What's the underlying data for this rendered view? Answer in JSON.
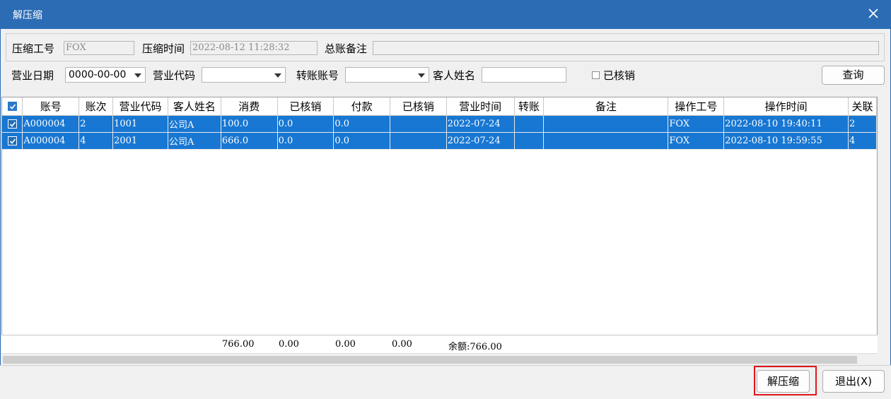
{
  "window": {
    "title": "解压缩",
    "close_label": "×"
  },
  "info": {
    "operator_label": "压缩工号",
    "operator_value": "FOX",
    "time_label": "压缩时间",
    "time_value": "2022-08-12 11:28:32",
    "note_label": "总账备注",
    "note_value": ""
  },
  "filters": {
    "date_label": "营业日期",
    "date_value": "0000-00-00",
    "code_label": "营业代码",
    "code_value": "",
    "account_label": "转账账号",
    "account_value": "",
    "customer_label": "客人姓名",
    "customer_value": "",
    "verified_label": "已核销",
    "verified_checked": false,
    "query_button": "查询"
  },
  "table": {
    "columns": [
      "账号",
      "账次",
      "营业代码",
      "客人姓名",
      "消费",
      "已核销",
      "付款",
      "已核销",
      "营业时间",
      "转账",
      "备注",
      "操作工号",
      "操作时间",
      "关联"
    ],
    "rows": [
      [
        "A000004",
        "2",
        "1001",
        "公司A",
        "100.0",
        "0.0",
        "0.0",
        "",
        "2022-07-24",
        "",
        "",
        "FOX",
        "2022-08-10 19:40:11",
        "2"
      ],
      [
        "A000004",
        "4",
        "2001",
        "公司A",
        "666.0",
        "0.0",
        "0.0",
        "",
        "2022-07-24",
        "",
        "",
        "FOX",
        "2022-08-10 19:59:55",
        "4"
      ]
    ]
  },
  "summary": {
    "consume_total": "766.00",
    "verified_total": "0.00",
    "payment_total": "0.00",
    "verified2_total": "0.00",
    "balance": "余额:766.00"
  },
  "buttons": {
    "decompress": "解压缩",
    "exit": "退出(X)"
  },
  "colors": {
    "titlebar": "#2b6cb5",
    "selection": "#1877d2",
    "highlight_border": "#e0161c"
  }
}
